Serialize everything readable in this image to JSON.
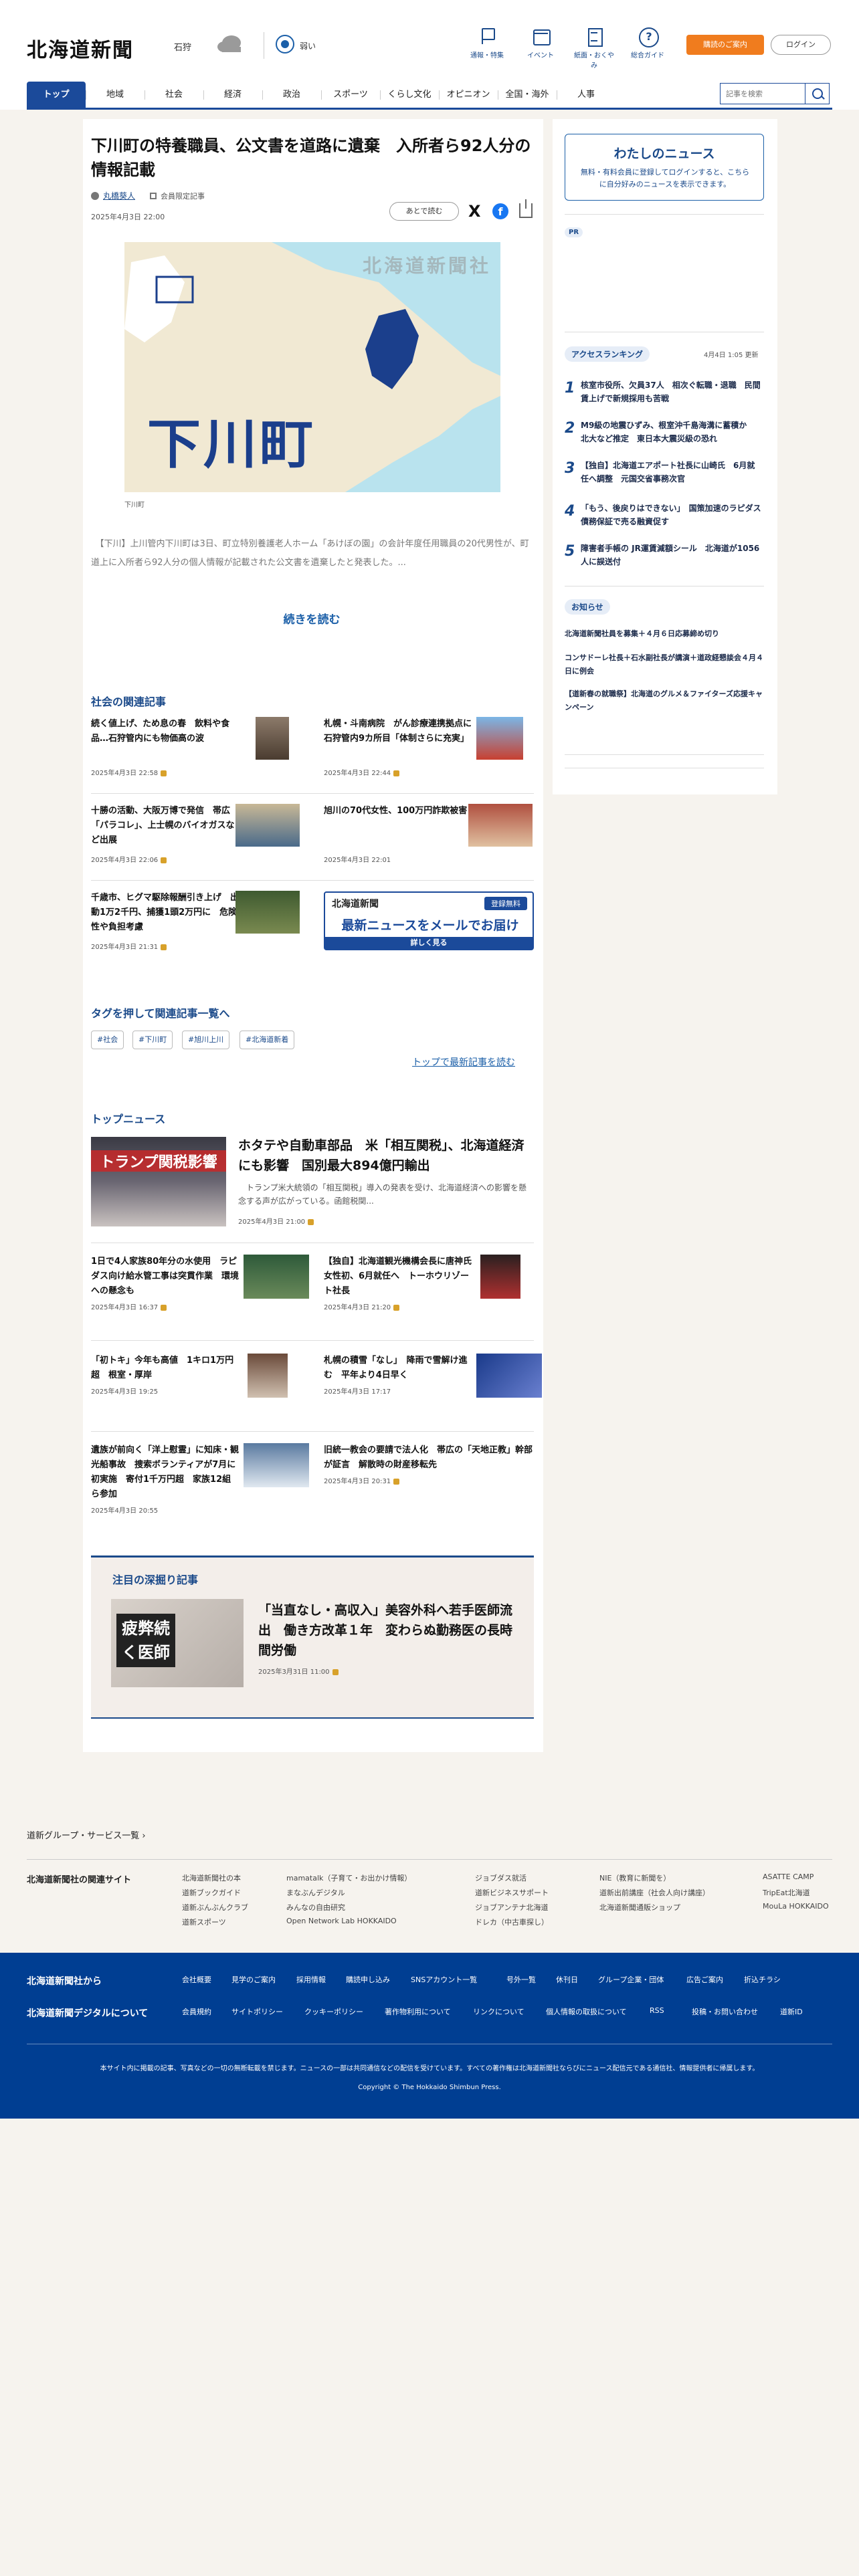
{
  "header": {
    "logo": "北海道新聞",
    "city": "石狩",
    "uv": "弱い",
    "nav": [
      "通報・特集",
      "イベント",
      "紙面・おくやみ",
      "総合ガイド"
    ],
    "cart": "購読のご案内",
    "login": "ログイン"
  },
  "tabs": [
    "トップ",
    "地域",
    "社会",
    "経済",
    "政治",
    "スポーツ",
    "くらし文化",
    "オピニオン",
    "全国・海外",
    "人事"
  ],
  "search": {
    "placeholder": "記事を検索"
  },
  "article": {
    "title": "下川町の特養職員、公文書を道路に遺棄　入所者ら92人分の情報記載",
    "author": "丸橋葵人",
    "members": "会員限定記事",
    "date": "2025年4月3日 22:00",
    "later": "あとで読む",
    "hero_text": "下川町",
    "hero_watermark": "北海道新聞社",
    "hero_caption": "下川町",
    "lead": "　【下川】上川管内下川町は3日、町立特別養護老人ホーム「あけぼの園」の会計年度任用職員の20代男性が、町道上に入所者ら92人分の個人情報が記載された公文書を遺棄したと発表した。...",
    "read_more": "続きを読む"
  },
  "related": {
    "title": "社会の関連記事",
    "items": [
      {
        "title": "続く値上げ、ため息の春　飲料や食品…石狩管内にも物価高の波",
        "date": "2025年4月3日 22:58"
      },
      {
        "title": "札幌・斗南病院　がん診療連携拠点に　石狩管内9カ所目「体制さらに充実」",
        "date": "2025年4月3日 22:44"
      },
      {
        "title": "十勝の活動、大阪万博で発信　帯広「パラコレ」、上士幌のバイオガスなど出展",
        "date": "2025年4月3日 22:06"
      },
      {
        "title": "旭川の70代女性、100万円詐欺被害",
        "date": "2025年4月3日 22:01"
      },
      {
        "title": "千歳市、ヒグマ駆除報酬引き上げ　出動1万2千円、捕獲1頭2万円に　危険性や負担考慮",
        "date": "2025年4月3日 21:31"
      }
    ]
  },
  "mail_banner": {
    "logo": "北海道新聞",
    "free": "登録無料",
    "main": "最新ニュースをメールでお届け",
    "more": "詳しく見る"
  },
  "tags": {
    "title": "タグを押して関連記事一覧へ",
    "items": [
      "#社会",
      "#下川町",
      "#旭川上川",
      "#北海道新着"
    ]
  },
  "latest_link": "トップで最新記事を読む",
  "top_news": {
    "title": "トップニュース",
    "hero": {
      "title": "ホタテや自動車部品　米「相互関税」、北海道経済にも影響　国別最大894億円輸出",
      "body": "　トランプ米大統領の「相互関税」導入の発表を受け、北海道経済への影響を懸念する声が広がっている。函館税関...",
      "date": "2025年4月3日 21:00",
      "img_text": "トランプ関税影響"
    },
    "items": [
      {
        "title": "1日で4人家族80年分の水使用　ラピダス向け給水管工事は突貫作業　環境への懸念も",
        "date": "2025年4月3日 16:37"
      },
      {
        "title": "【独自】北海道観光機構会長に唐神氏　女性初、6月就任へ　トーホウリゾート社長",
        "date": "2025年4月3日 21:20"
      },
      {
        "title": "「初トキ」今年も高値　1キロ1万円超　根室・厚岸",
        "date": "2025年4月3日 19:25"
      },
      {
        "title": "札幌の積雪「なし」　降雨で雪解け進む　平年より4日早く",
        "date": "2025年4月3日 17:17"
      },
      {
        "title": "遺族が前向く「洋上慰霊」に知床・観光船事故　捜索ボランティアが7月に初実施　寄付1千万円超　家族12組ら参加",
        "date": "2025年4月3日 20:55"
      },
      {
        "title": "旧統一教会の要請で法人化　帯広の「天地正教」幹部が証言　解散時の財産移転先",
        "date": "2025年4月3日 20:31"
      }
    ]
  },
  "deep": {
    "title": "注目の深掘り記事",
    "img_text": "疲弊続く医師",
    "headline": "「当直なし・高収入」美容外科へ若手医師流出　働き方改革１年　変わらぬ勤務医の長時間労働",
    "date": "2025年3月31日 11:00"
  },
  "sidebar": {
    "mynews": {
      "title": "わたしのニュース",
      "body": "無料・有料会員に登録してログインすると、こちらに自分好みのニュースを表示できます。"
    },
    "pr": "PR",
    "ranking": {
      "title": "アクセスランキング",
      "time": "4月4日 1:05 更新",
      "items": [
        "核室市役所、欠員37人　相次ぐ転職・退職　民間賃上げで新規採用も苦戦",
        "M9級の地震ひずみ、根室沖千島海溝に蓄積か　北大など推定　東日本大震災級の恐れ",
        "【独自】北海道エアポート社長に山崎氏　6月就任へ調整　元国交省事務次官",
        "「もう、後戻りはできない」　国策加速のラピダス　債務保証で売る融資促す",
        "障害者手帳の JR運賃減額シール　北海道が1056人に誤送付"
      ]
    },
    "notice": {
      "title": "お知らせ",
      "items": [
        "北海道新聞社員を募集＋４月６日応募締め切り",
        "コンサドーレ社長＋石水副社長が講演＋道政経懇談会４月４日に例会",
        "【道新春の就職祭】北海道のグルメ＆ファイターズ応援キャンペーン"
      ]
    }
  },
  "footer": {
    "group": "道新グループ・サービス一覧",
    "related_title": "北海道新聞社の関連サイト",
    "related_cols": [
      [
        "北海道新聞社の本",
        "道新ブックガイド",
        "道新ぶんぶんクラブ",
        "道新スポーツ"
      ],
      [
        "mamatalk（子育て・お出かけ情報）",
        "まなぶんデジタル",
        "みんなの自由研究",
        "Open Network Lab HOKKAIDO"
      ],
      [
        "ジョブダス就活",
        "道新ビジネスサポート",
        "ジョブアンテナ北海道",
        "ドレカ（中古車探し）"
      ],
      [
        "NIE（教育に新聞を）",
        "道新出前講座（社会人向け講座）",
        "北海道新聞通販ショップ"
      ],
      [
        "ASATTE CAMP",
        "TripEat北海道",
        "MouLa HOKKAIDO"
      ]
    ],
    "from_title": "北海道新聞社から",
    "from_links": [
      "会社概要",
      "見学のご案内",
      "採用情報",
      "購読申し込み",
      "SNSアカウント一覧",
      "号外一覧",
      "休刊日",
      "グループ企業・団体",
      "広告ご案内",
      "折込チラシ"
    ],
    "digital_title": "北海道新聞デジタルについて",
    "digital_links": [
      "会員規約",
      "サイトポリシー",
      "クッキーポリシー",
      "著作物利用について",
      "リンクについて",
      "個人情報の取扱について",
      "RSS",
      "投稿・お問い合わせ",
      "道新ID"
    ],
    "note": "本サイト内に掲載の記事、写真などの一切の無断転載を禁じます。ニュースの一部は共同通信などの配信を受けています。すべての著作権は北海道新聞社ならびにニュース配信元である通信社、情報提供者に帰属します。",
    "copyright": "Copyright © The Hokkaido Shimbun Press."
  }
}
